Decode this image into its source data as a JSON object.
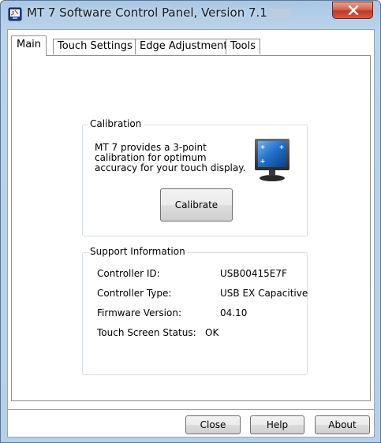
{
  "window": {
    "title": "MT 7 Software Control Panel, Version 7.1",
    "close_symbol": "✕"
  },
  "tabs": [
    {
      "label": "Main",
      "active": true
    },
    {
      "label": "Touch Settings",
      "active": false
    },
    {
      "label": "Edge Adjustment",
      "active": false
    },
    {
      "label": "Tools",
      "active": false
    }
  ],
  "calibration": {
    "title": "Calibration",
    "description": "MT 7 provides a 3-point\ncalibration for optimum\naccuracy for your touch display.",
    "button_label": "Calibrate",
    "icon": "monitor-icon"
  },
  "support": {
    "title": "Support Information",
    "rows": [
      {
        "label": "Controller ID:",
        "value": "USB00415E7F"
      },
      {
        "label": "Controller Type:",
        "value": "USB EX Capacitive"
      },
      {
        "label": "Firmware Version:",
        "value": "04.10"
      },
      {
        "label": "Touch Screen Status:",
        "value": "OK"
      }
    ]
  },
  "footer": {
    "close_label": "Close",
    "help_label": "Help",
    "about_label": "About"
  },
  "colors": {
    "titlebar": "#b8cfe6",
    "close_button": "#c0392b",
    "monitor_screen": "#1f6fc8"
  }
}
